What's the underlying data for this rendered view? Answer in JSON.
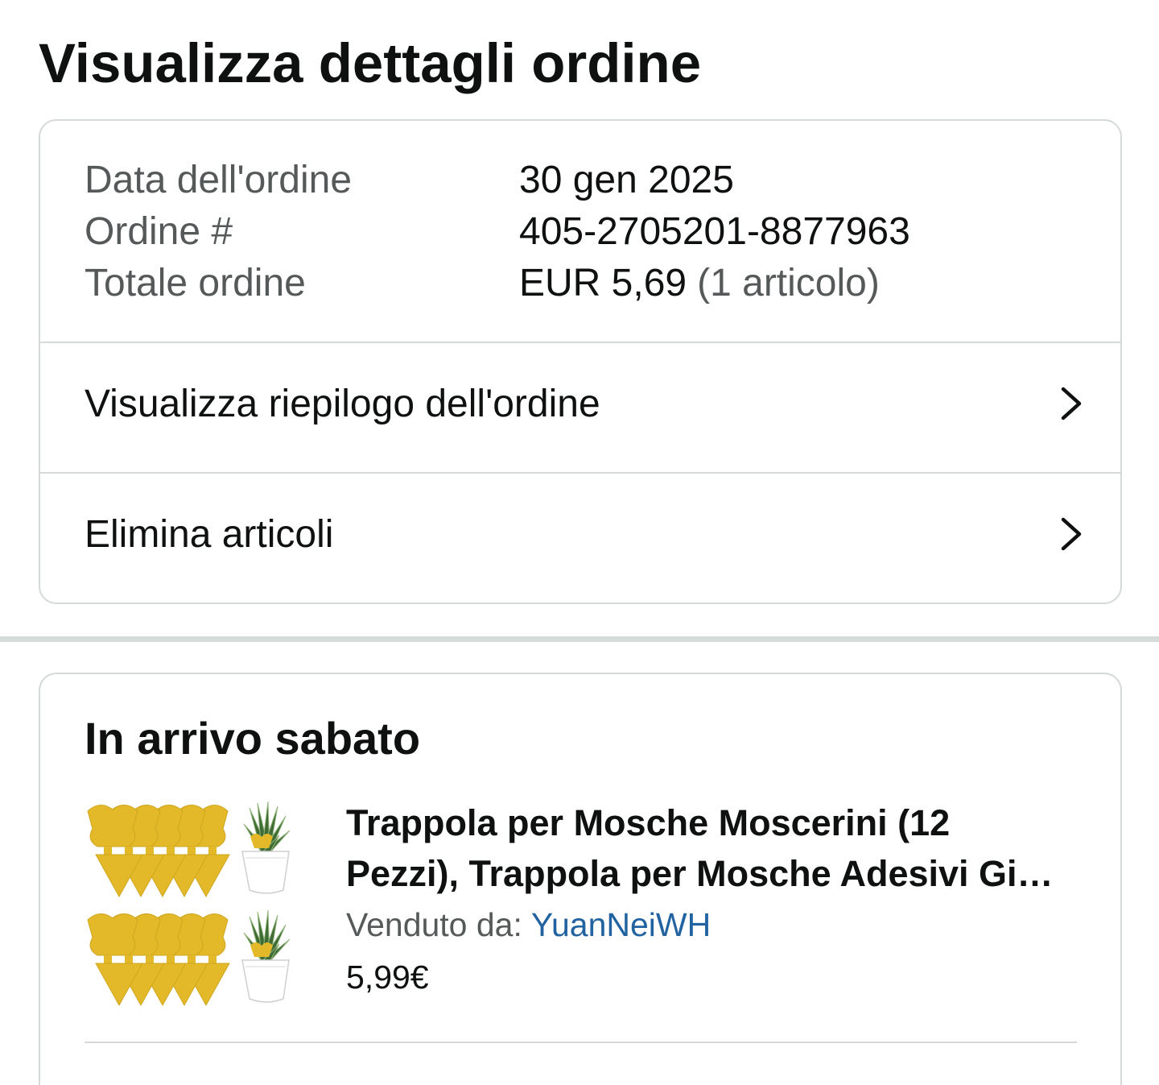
{
  "page": {
    "title": "Visualizza dettagli ordine"
  },
  "order_info": {
    "rows": [
      {
        "label": "Data dell'ordine",
        "value": "30 gen 2025"
      },
      {
        "label": "Ordine #",
        "value": "405-2705201-8877963"
      },
      {
        "label": "Totale ordine",
        "value": "EUR 5,69",
        "note": "(1 articolo)"
      }
    ]
  },
  "actions": [
    {
      "label": "Visualizza riepilogo dell'ordine",
      "icon": "chevron-right-icon"
    },
    {
      "label": "Elimina articoli",
      "icon": "chevron-right-icon"
    }
  ],
  "shipment": {
    "heading": "In arrivo sabato",
    "item": {
      "image": "product-thumbnail-yellow-sticky-traps",
      "title": "Trappola per Mosche Moscerini (12 Pezzi), Trappola per Mosche Adesivi Gi…",
      "sold_by_label": "Venduto da:",
      "seller": "YuanNeiWH",
      "price": "5,99€"
    }
  },
  "colors": {
    "text": "#0f1111",
    "muted": "#565959",
    "link": "#2162a1",
    "border": "#d5d9d9",
    "band": "#d5dbdb",
    "yellow": "#e3b92a"
  }
}
